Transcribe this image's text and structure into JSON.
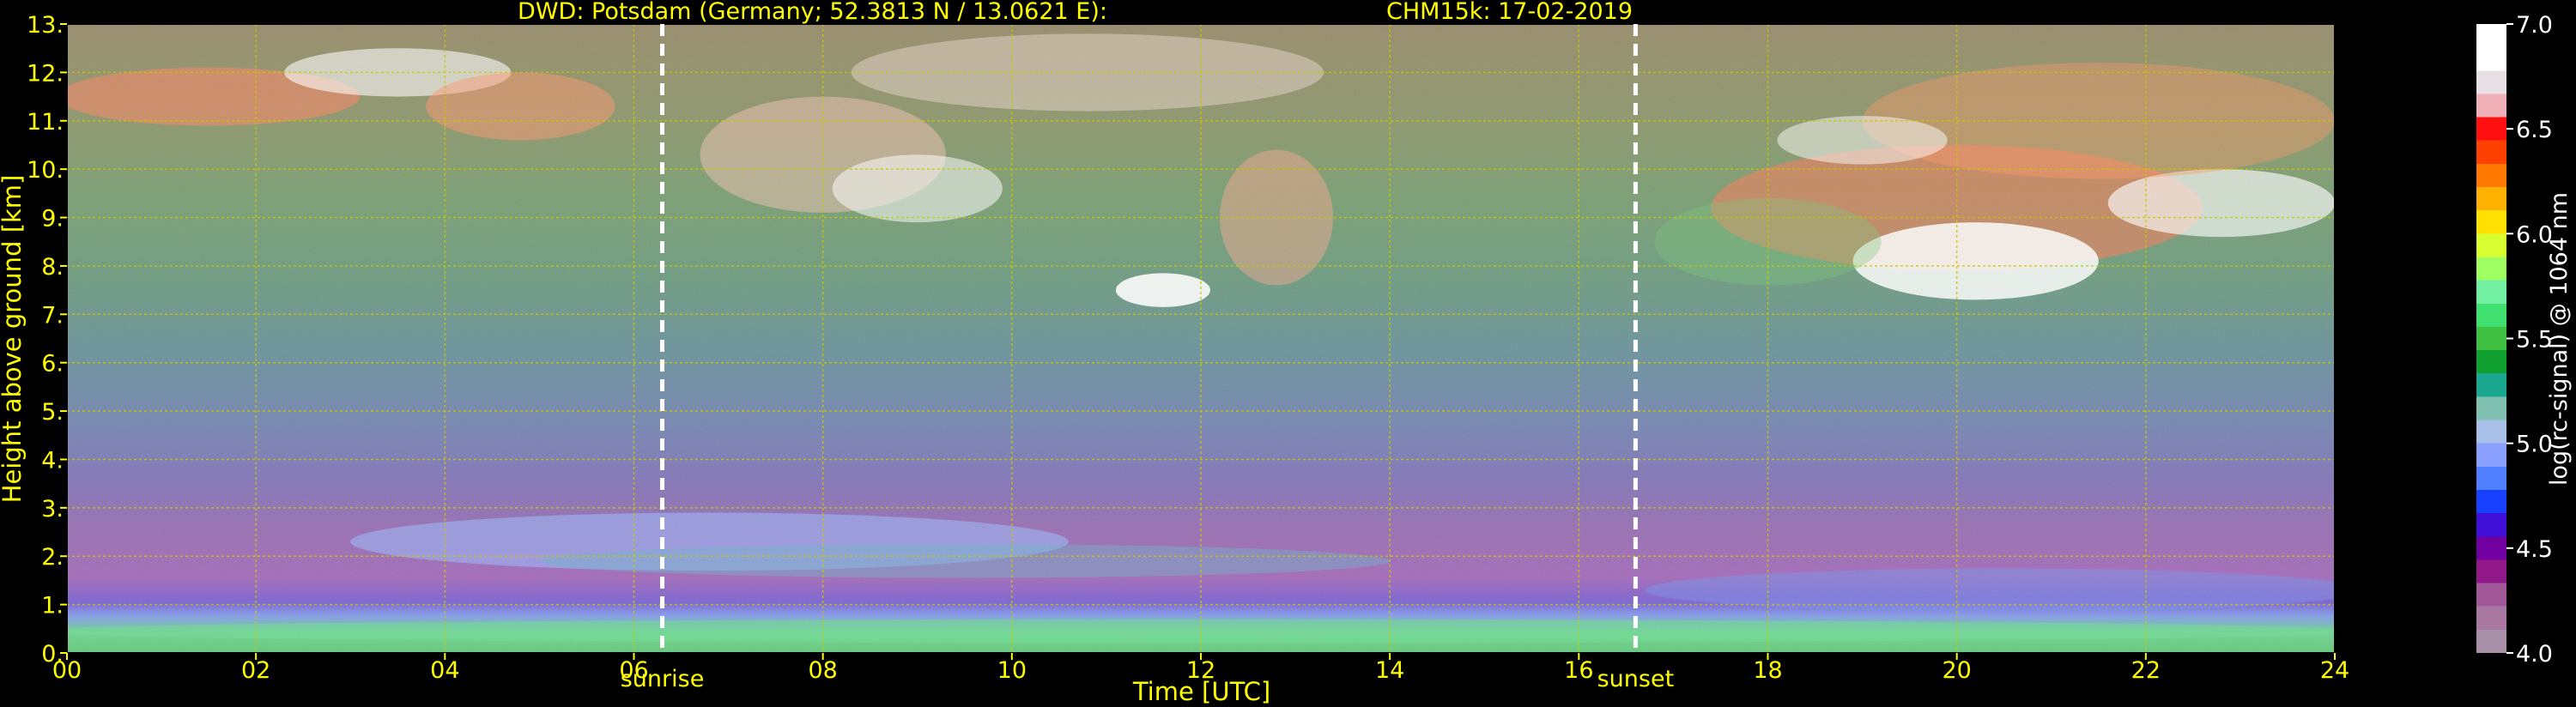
{
  "chart_data": {
    "type": "heatmap",
    "title_left": "DWD: Potsdam (Germany; 52.3813 N / 13.0621 E):",
    "title_right": "CHM15k: 17-02-2019",
    "xlabel": "Time [UTC]",
    "ylabel": "Height above ground [km]",
    "xlim": [
      0,
      24
    ],
    "ylim": [
      0,
      13
    ],
    "x_ticks": [
      0,
      2,
      4,
      6,
      8,
      10,
      12,
      14,
      16,
      18,
      20,
      22,
      24
    ],
    "x_tick_labels": [
      "00",
      "02",
      "04",
      "06",
      "08",
      "10",
      "12",
      "14",
      "16",
      "18",
      "20",
      "22",
      "24"
    ],
    "y_ticks": [
      0,
      1,
      2,
      3,
      4,
      5,
      6,
      7,
      8,
      9,
      10,
      11,
      12,
      13
    ],
    "y_tick_labels": [
      "0.",
      "1.",
      "2.",
      "3.",
      "4.",
      "5.",
      "6.",
      "7.",
      "8.",
      "9.",
      "10.",
      "11.",
      "12.",
      "13."
    ],
    "grid": true,
    "grid_color": "#c8c800",
    "markers": [
      {
        "x": 6.3,
        "label": "sunrise"
      },
      {
        "x": 16.6,
        "label": "sunset"
      }
    ],
    "colorbar": {
      "label": "log(rc-signal) @ 1064 nm",
      "range": [
        4.0,
        7.0
      ],
      "ticks": [
        4.0,
        4.5,
        5.0,
        5.5,
        6.0,
        6.5,
        7.0
      ],
      "tick_labels": [
        "4.0",
        "4.5",
        "5.0",
        "5.5",
        "6.0",
        "6.5",
        "7.0"
      ],
      "colors": [
        "#a890a8",
        "#a878a0",
        "#a05898",
        "#901888",
        "#7000a0",
        "#4010d8",
        "#1840ff",
        "#5080ff",
        "#8aa0ff",
        "#a8c0e8",
        "#80c0b0",
        "#1aa890",
        "#10a030",
        "#40c040",
        "#40e070",
        "#70f0a0",
        "#a0ff60",
        "#d8ff30",
        "#ffe000",
        "#ffb000",
        "#ff7800",
        "#ff4000",
        "#ff1010",
        "#f0b0b8",
        "#e8e0e4",
        "#ffffff",
        "#ffffff"
      ]
    }
  }
}
